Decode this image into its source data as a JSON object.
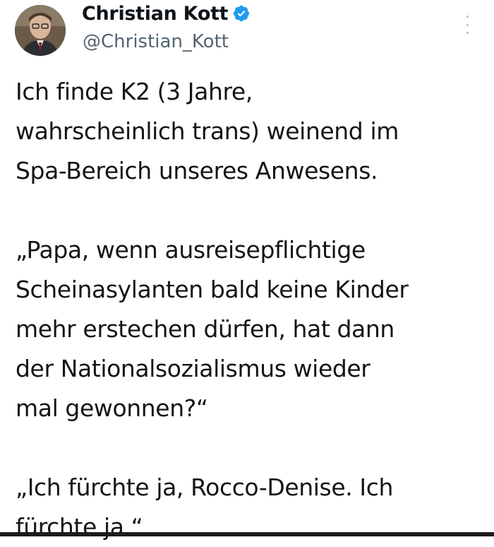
{
  "author": {
    "display_name": "Christian Kott",
    "handle": "@Christian_Kott",
    "verified": true,
    "avatar": "avatar-photo"
  },
  "icons": {
    "verified": "verified-badge-icon",
    "more": "more-options-icon"
  },
  "colors": {
    "verified_blue": "#1d9bf0",
    "handle_gray": "#536471",
    "text": "#141414"
  },
  "tweet": {
    "paragraphs": [
      "Ich finde K2 (3 Jahre,\nwahrscheinlich trans) weinend im\nSpa-Bereich unseres Anwesens.",
      "„Papa, wenn ausreisepflichtige\nScheinasylanten bald keine Kinder\nmehr erstechen dürfen, hat dann\nder Nationalsozialismus wieder\nmal gewonnen?“",
      "„Ich fürchte ja, Rocco-Denise. Ich\nfürchte ja.“"
    ]
  }
}
